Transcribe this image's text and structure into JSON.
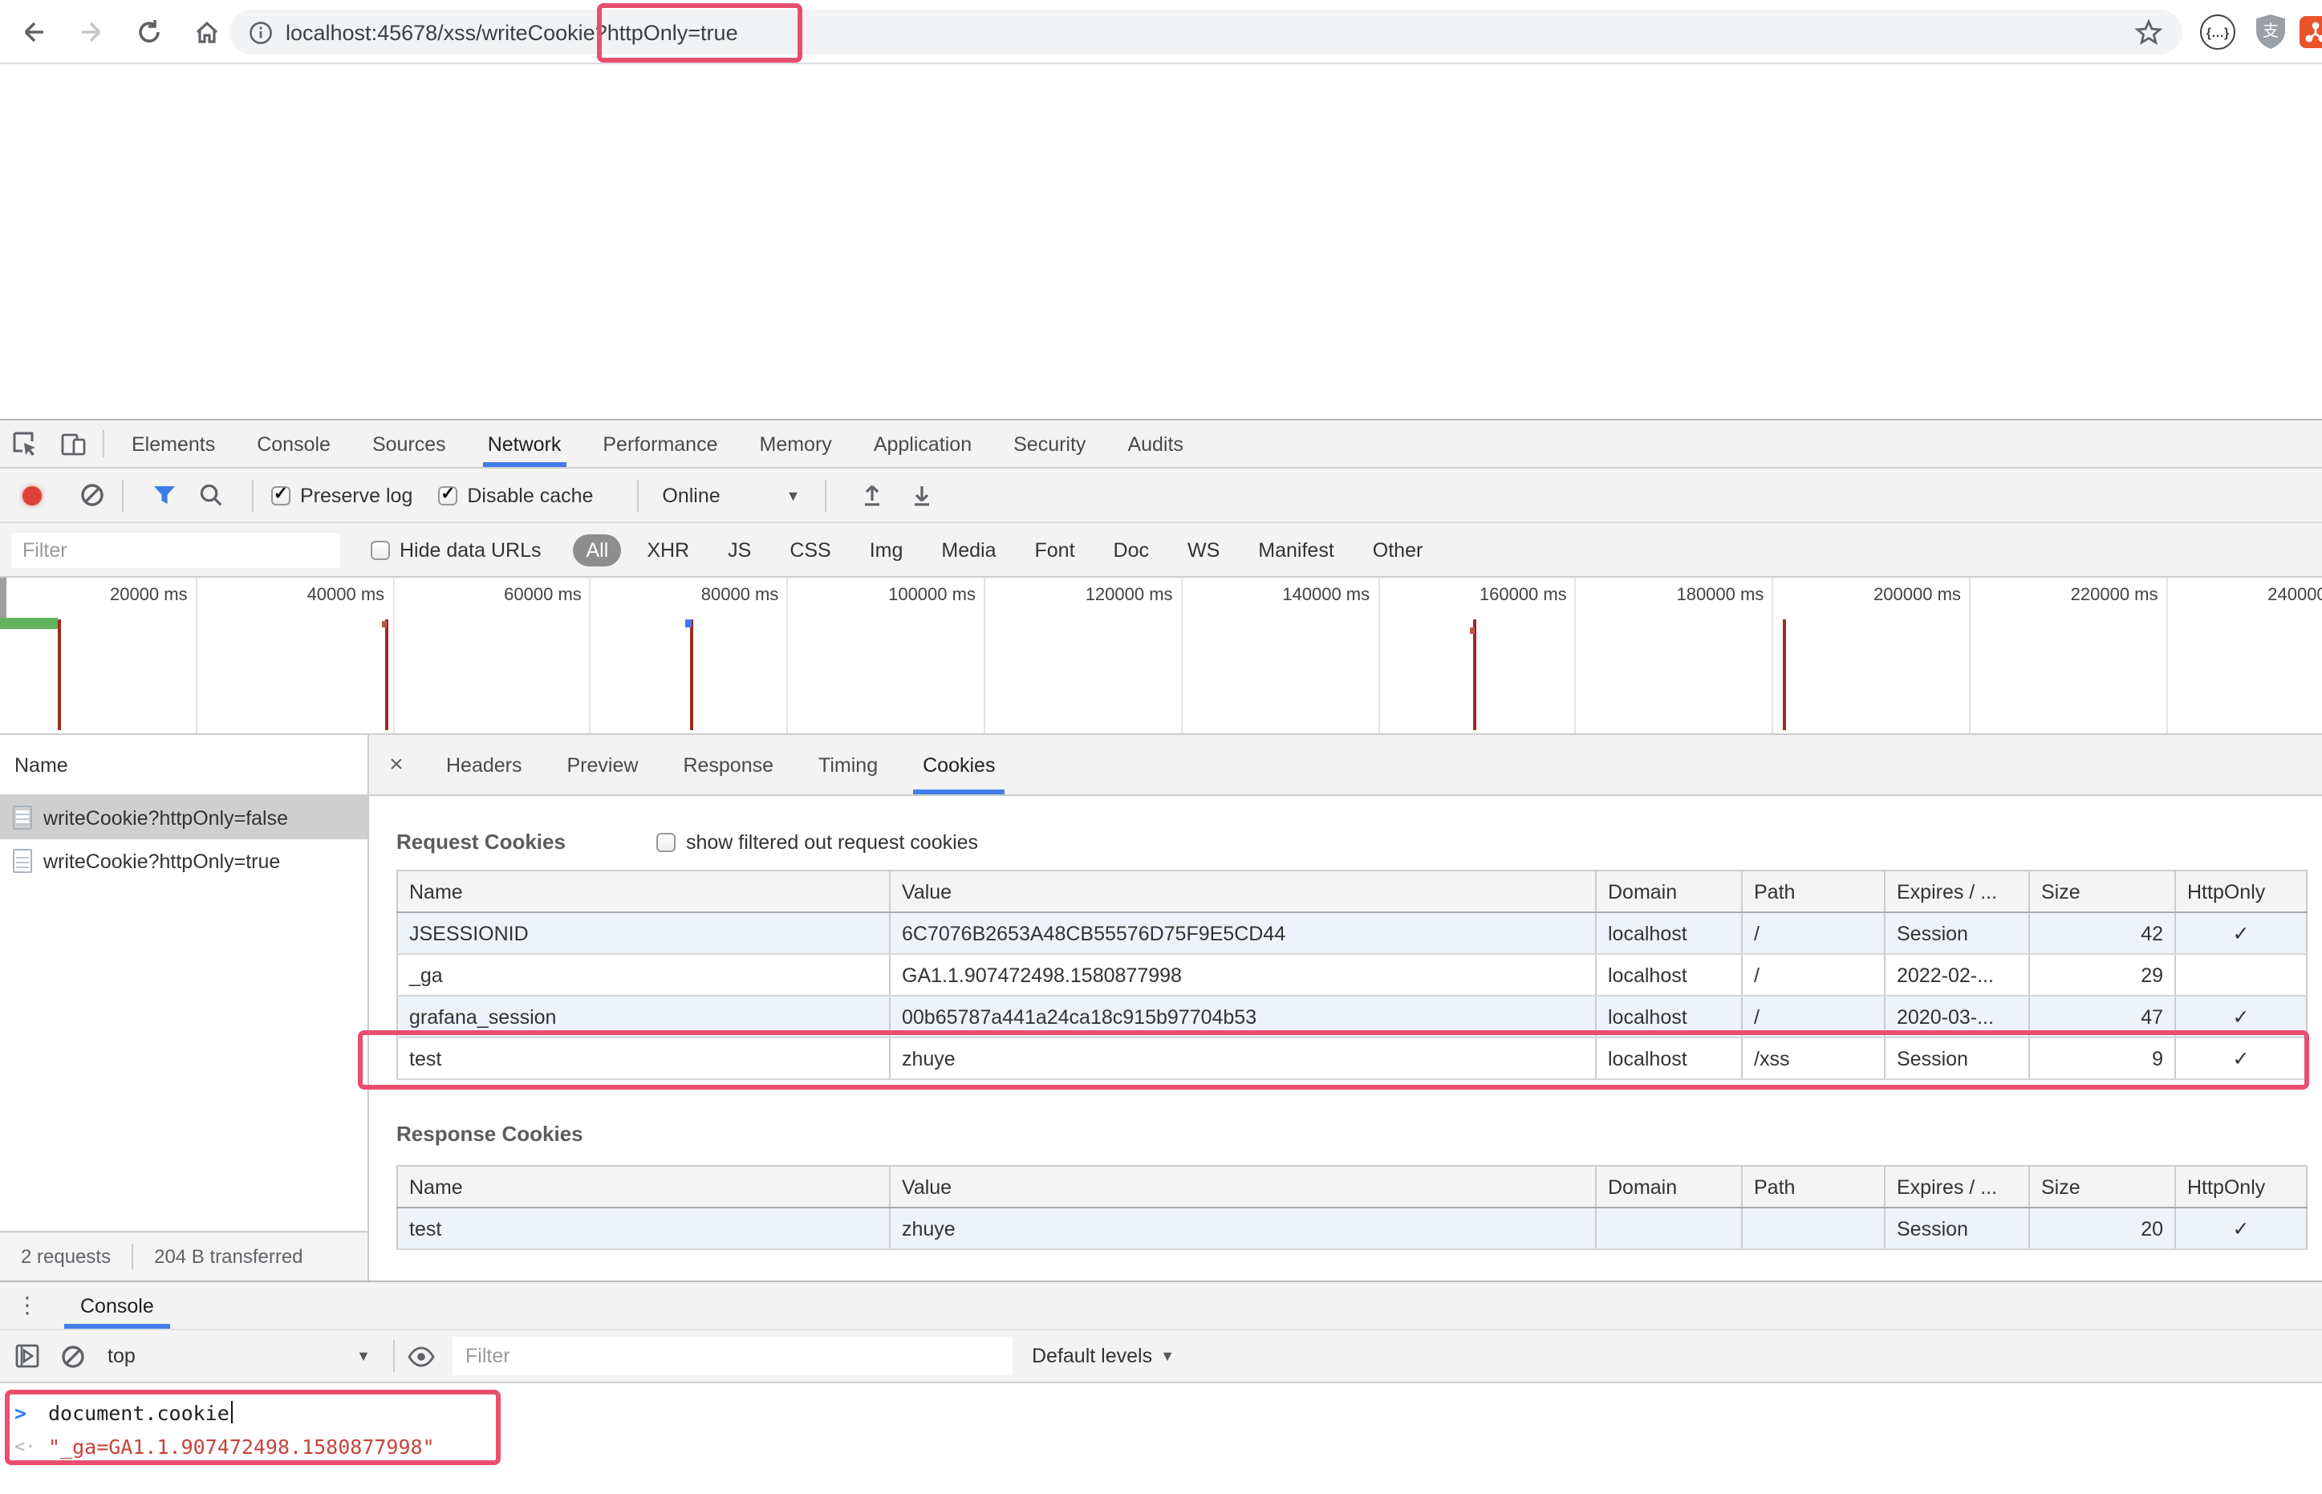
{
  "browser": {
    "url_prefix": "localhost:45678/xss/writeCookie",
    "url_highlight": "?httpOnly=true"
  },
  "devtools": {
    "tabs": [
      "Elements",
      "Console",
      "Sources",
      "Network",
      "Performance",
      "Memory",
      "Application",
      "Security",
      "Audits"
    ],
    "active_tab": "Network",
    "network_toolbar": {
      "preserve_log": "Preserve log",
      "disable_cache": "Disable cache",
      "throttling": "Online"
    },
    "filter_bar": {
      "placeholder": "Filter",
      "hide_data_urls": "Hide data URLs",
      "types": [
        "All",
        "XHR",
        "JS",
        "CSS",
        "Img",
        "Media",
        "Font",
        "Doc",
        "WS",
        "Manifest",
        "Other"
      ],
      "active_type": "All"
    },
    "timeline_labels": [
      "20000 ms",
      "40000 ms",
      "60000 ms",
      "80000 ms",
      "100000 ms",
      "120000 ms",
      "140000 ms",
      "160000 ms",
      "180000 ms",
      "200000 ms",
      "220000 ms",
      "240000 ms"
    ],
    "request_list": {
      "header": "Name",
      "items": [
        "writeCookie?httpOnly=false",
        "writeCookie?httpOnly=true"
      ]
    },
    "status_bar": {
      "requests": "2 requests",
      "transferred": "204 B transferred"
    },
    "detail": {
      "tabs": [
        "Headers",
        "Preview",
        "Response",
        "Timing",
        "Cookies"
      ],
      "active_tab": "Cookies",
      "request_cookies": {
        "title": "Request Cookies",
        "filter_checkbox_label": "show filtered out request cookies",
        "columns": [
          "Name",
          "Value",
          "Domain",
          "Path",
          "Expires / ...",
          "Size",
          "HttpOnly"
        ],
        "rows": [
          [
            "JSESSIONID",
            "6C7076B2653A48CB55576D75F9E5CD44",
            "localhost",
            "/",
            "Session",
            "42",
            "✓"
          ],
          [
            "_ga",
            "GA1.1.907472498.1580877998",
            "localhost",
            "/",
            "2022-02-...",
            "29",
            ""
          ],
          [
            "grafana_session",
            "00b65787a441a24ca18c915b97704b53",
            "localhost",
            "/",
            "2020-03-...",
            "47",
            "✓"
          ],
          [
            "test",
            "zhuye",
            "localhost",
            "/xss",
            "Session",
            "9",
            "✓"
          ]
        ]
      },
      "response_cookies": {
        "title": "Response Cookies",
        "columns": [
          "Name",
          "Value",
          "Domain",
          "Path",
          "Expires / ...",
          "Size",
          "HttpOnly"
        ],
        "rows": [
          [
            "test",
            "zhuye",
            "",
            "",
            "Session",
            "20",
            "✓"
          ]
        ]
      }
    },
    "console": {
      "tab": "Console",
      "context": "top",
      "filter_placeholder": "Filter",
      "levels": "Default levels",
      "input": "document.cookie",
      "output": "\"_ga=GA1.1.907472498.1580877998\""
    }
  },
  "colors": {
    "accent_blue": "#437dec",
    "annotation_pink": "#e94e70",
    "record_red": "#df4238",
    "console_string_red": "#c5443c",
    "load_event_red": "#9c2b20",
    "dom_content_loaded_blue": "#4576f2",
    "waterfall_green": "#63b25e"
  }
}
